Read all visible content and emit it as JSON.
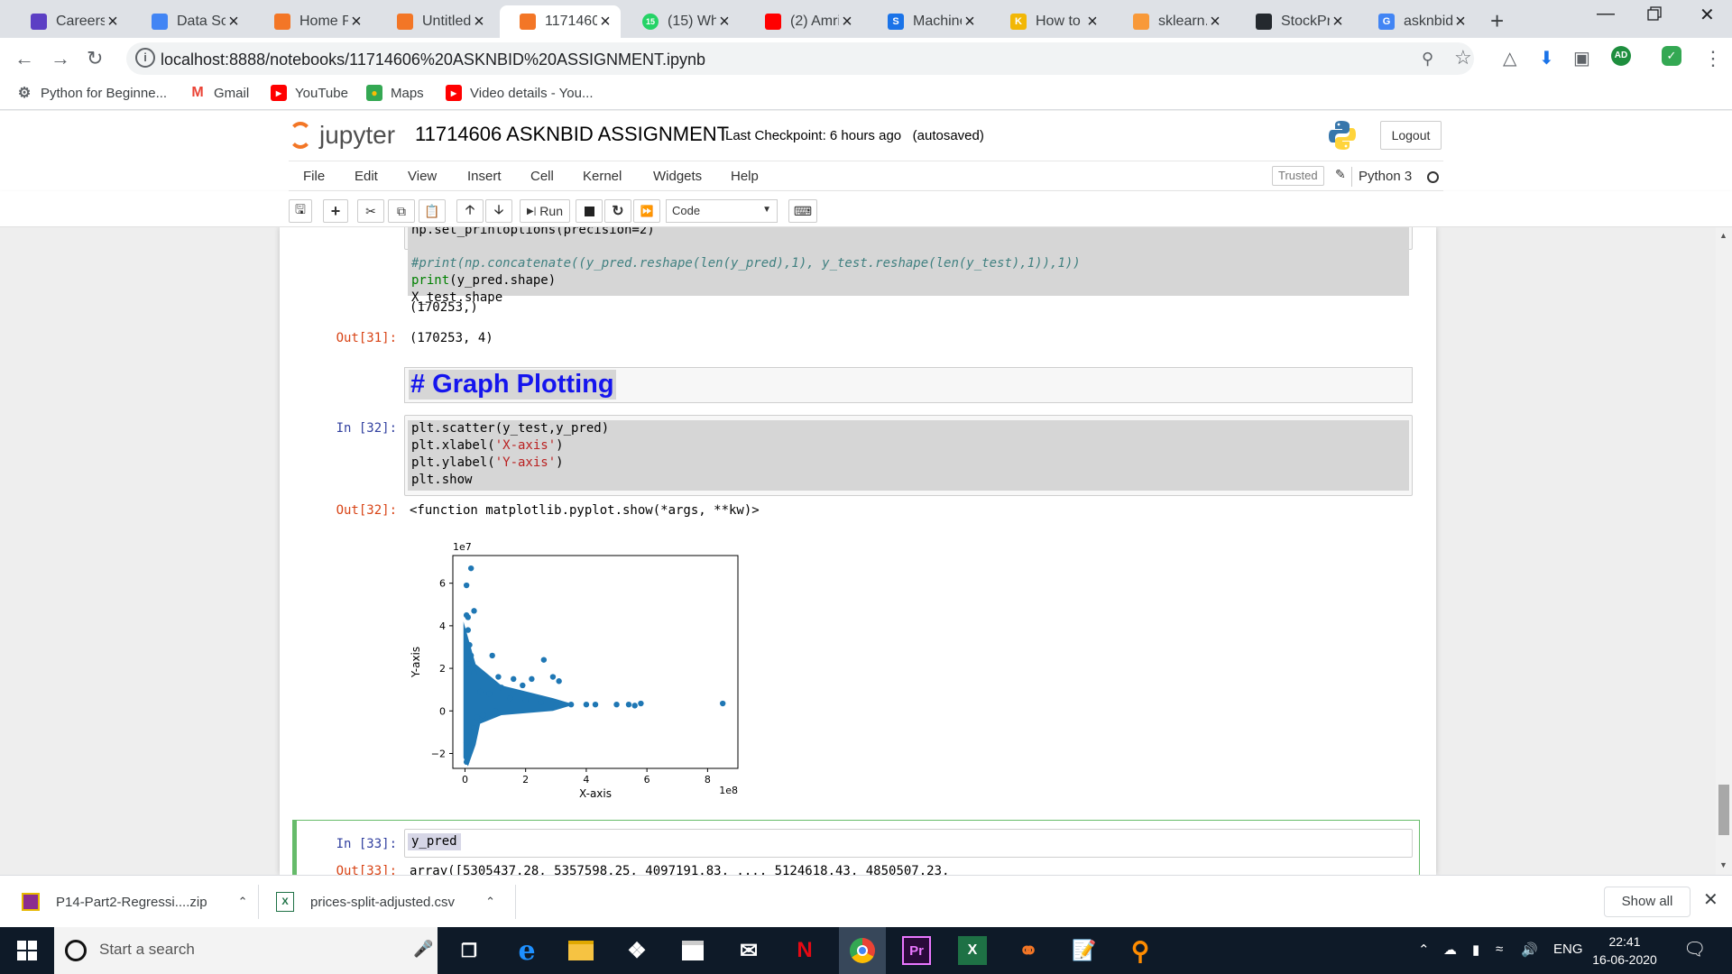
{
  "browser": {
    "tabs": [
      {
        "title": "Careers",
        "icon": "list-icon",
        "color": "#5c3fc4"
      },
      {
        "title": "Data Sci",
        "icon": "docs-icon",
        "color": "#4285f4"
      },
      {
        "title": "Home Pa",
        "icon": "jupyter-icon",
        "color": "#f37626"
      },
      {
        "title": "Untitled",
        "icon": "jupyter-icon",
        "color": "#f37626"
      },
      {
        "title": "1171460",
        "icon": "jupyter-icon",
        "color": "#f37626"
      },
      {
        "title": "(15) Wh",
        "icon": "whatsapp-icon",
        "color": "#25d366",
        "badge": "15"
      },
      {
        "title": "(2) Amri",
        "icon": "youtube-icon",
        "color": "#ff0000"
      },
      {
        "title": "Machine",
        "icon": "s-icon",
        "color": "#1a73e8",
        "letter": "S"
      },
      {
        "title": "How to",
        "icon": "k-icon",
        "color": "#f2b705",
        "letter": "K"
      },
      {
        "title": "sklearn.p",
        "icon": "sklearn-icon",
        "color": "#f89939"
      },
      {
        "title": "StockPre",
        "icon": "github-icon",
        "color": "#24292e"
      },
      {
        "title": "asknbid",
        "icon": "google-icon",
        "color": "#4285f4",
        "letter": "G"
      }
    ],
    "url": "localhost:8888/notebooks/11714606%20ASKNBID%20ASSIGNMENT.ipynb",
    "profile_initials": "AD",
    "bookmarks": [
      {
        "label": "Python for Beginne...",
        "icon": "globe-icon"
      },
      {
        "label": "Gmail",
        "icon": "gmail-icon",
        "letter": "M"
      },
      {
        "label": "YouTube",
        "icon": "youtube-icon"
      },
      {
        "label": "Maps",
        "icon": "maps-icon"
      },
      {
        "label": "Video details - You...",
        "icon": "youtube-icon"
      }
    ]
  },
  "jupyter": {
    "logo_text": "jupyter",
    "notebook_name": "11714606 ASKNBID ASSIGNMENT",
    "checkpoint": "Last Checkpoint: 6 hours ago",
    "autosaved": "(autosaved)",
    "logout_label": "Logout",
    "menu": [
      "File",
      "Edit",
      "View",
      "Insert",
      "Cell",
      "Kernel",
      "Widgets",
      "Help"
    ],
    "trusted_label": "Trusted",
    "kernel_name": "Python 3",
    "run_label": "Run",
    "cell_type": "Code"
  },
  "cells": {
    "cell31_partial": "np.set_printoptions(precision=2)",
    "cell31_line2": "#print(np.concatenate((y_pred.reshape(len(y_pred),1), y_test.reshape(len(y_test),1)),1))",
    "cell31_line3_kw": "print",
    "cell31_line3_rest": "(y_pred.shape)",
    "cell31_line4": "X_test.shape",
    "cell31_stdout": "(170253,)",
    "out31_prompt": "Out[31]:",
    "out31_value": "(170253, 4)",
    "markdown_heading": "# Graph Plotting",
    "in32_prompt": "In [32]:",
    "in32_l1": "plt.scatter(y_test,y_pred)",
    "in32_l2a": "plt.xlabel(",
    "in32_l2s": "'X-axis'",
    "in32_l2b": ")",
    "in32_l3a": "plt.ylabel(",
    "in32_l3s": "'Y-axis'",
    "in32_l3b": ")",
    "in32_l4": "plt.show",
    "out32_prompt": "Out[32]:",
    "out32_value": "<function matplotlib.pyplot.show(*args, **kw)>",
    "in33_prompt": "In [33]:",
    "in33_code": "y_pred",
    "out33_prompt": "Out[33]:",
    "out33_value": "array([5305437.28, 5357598.25, 4097191.83, ..., 5124618.43, 4850507.23,"
  },
  "chart_data": {
    "type": "scatter",
    "xlabel": "X-axis",
    "ylabel": "Y-axis",
    "x_offset_label": "1e8",
    "y_offset_label": "1e7",
    "xlim": [
      -0.4,
      9.0
    ],
    "ylim": [
      -2.7,
      7.3
    ],
    "xticks": [
      0,
      2,
      4,
      6,
      8
    ],
    "yticks": [
      -2,
      0,
      2,
      4,
      6
    ],
    "xtick_labels": [
      "0",
      "2",
      "4",
      "6",
      "8"
    ],
    "ytick_labels": [
      "−2",
      "0",
      "2",
      "4",
      "6"
    ],
    "color": "#1f77b4",
    "series": [
      {
        "points": [
          [
            0.05,
            5.9
          ],
          [
            0.2,
            6.7
          ],
          [
            0.3,
            4.7
          ],
          [
            0.05,
            4.5
          ],
          [
            0.1,
            4.4
          ],
          [
            0.9,
            2.6
          ],
          [
            2.6,
            2.4
          ],
          [
            2.9,
            1.6
          ],
          [
            3.1,
            1.4
          ],
          [
            2.2,
            1.5
          ],
          [
            1.9,
            1.2
          ],
          [
            1.6,
            1.5
          ],
          [
            1.1,
            1.6
          ],
          [
            1.2,
            1.1
          ],
          [
            0.1,
            3.8
          ],
          [
            0.15,
            3.1
          ],
          [
            0.2,
            2.6
          ],
          [
            0.1,
            2.2
          ],
          [
            0.3,
            1.8
          ],
          [
            0.05,
            -2.4
          ],
          [
            0.1,
            -2.0
          ],
          [
            0.05,
            -1.5
          ],
          [
            3.5,
            0.3
          ],
          [
            4.0,
            0.3
          ],
          [
            4.3,
            0.3
          ],
          [
            5.0,
            0.3
          ],
          [
            5.4,
            0.3
          ],
          [
            5.6,
            0.25
          ],
          [
            5.8,
            0.35
          ],
          [
            8.5,
            0.35
          ],
          [
            0.5,
            0.9
          ],
          [
            0.8,
            0.8
          ],
          [
            1.5,
            0.6
          ],
          [
            2.0,
            0.5
          ],
          [
            2.5,
            0.4
          ],
          [
            3.0,
            0.3
          ],
          [
            0.4,
            -0.3
          ],
          [
            0.6,
            -0.2
          ],
          [
            1.0,
            0.0
          ],
          [
            0.3,
            -0.8
          ],
          [
            0.2,
            -1.0
          ]
        ]
      }
    ]
  },
  "downloads": {
    "items": [
      {
        "name": "P14-Part2-Regressi....zip",
        "icon": "zip-icon"
      },
      {
        "name": "prices-split-adjusted.csv",
        "icon": "excel-icon"
      }
    ],
    "show_all": "Show all"
  },
  "taskbar": {
    "search_placeholder": "Start a search",
    "language": "ENG",
    "time": "22:41",
    "date": "16-06-2020"
  }
}
